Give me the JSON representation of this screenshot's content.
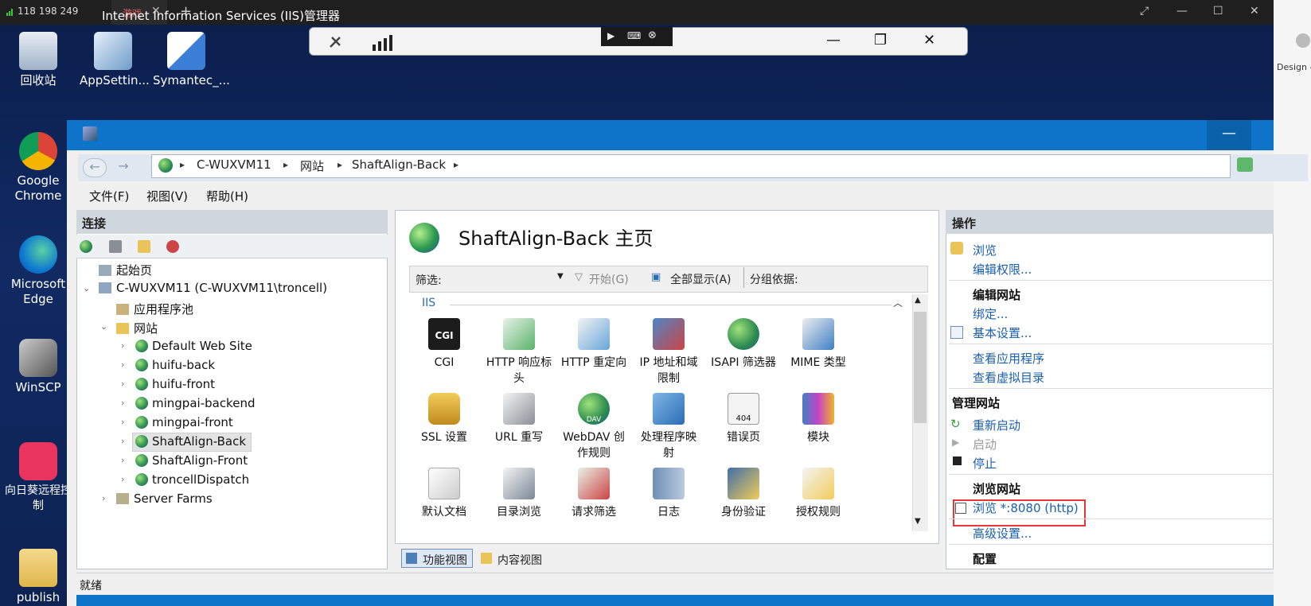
{
  "topbar": {
    "signal": "118 198 249",
    "tab_label": "游戏",
    "tab_close": "✕",
    "tab_add": "+",
    "ctl_restore": "⤢",
    "ctl_min": "—",
    "ctl_max": "☐",
    "ctl_close": "✕"
  },
  "desktop": {
    "icons": [
      {
        "label": "回收站"
      },
      {
        "label": "AppSettin..."
      },
      {
        "label": "Symantec_..."
      },
      {
        "label": "Google Chrome"
      },
      {
        "label": "Microsoft Edge"
      },
      {
        "label": "WinSCP"
      },
      {
        "label": "向日葵远程控制"
      },
      {
        "label": "publish"
      }
    ]
  },
  "remote_toolbar": {
    "min": "—",
    "max": "❐",
    "close": "✕"
  },
  "right_strip": {
    "text": "Design - B"
  },
  "iis": {
    "title": "Internet Information Services (IIS)管理器",
    "min": "—",
    "address": {
      "host": "C-WUXVM11",
      "sites": "网站",
      "site": "ShaftAlign-Back",
      "sep": "▸"
    },
    "menu": {
      "file": "文件(F)",
      "view": "视图(V)",
      "help": "帮助(H)"
    },
    "connections": {
      "title": "连接",
      "tree": {
        "start": "起始页",
        "server": "C-WUXVM11 (C-WUXVM11\\troncell)",
        "apppools": "应用程序池",
        "sites": "网站",
        "site_list": [
          "Default Web Site",
          "huifu-back",
          "huifu-front",
          "mingpai-backend",
          "mingpai-front",
          "ShaftAlign-Back",
          "ShaftAlign-Front",
          "troncellDispatch"
        ],
        "farms": "Server Farms"
      }
    },
    "center": {
      "title": "ShaftAlign-Back 主页",
      "filter_label": "筛选:",
      "start": "开始(G)",
      "show_all": "全部显示(A)",
      "group_by": "分组依据:",
      "group": "IIS",
      "features": [
        {
          "l1": "CGI",
          "l2": ""
        },
        {
          "l1": "HTTP 响应标",
          "l2": "头"
        },
        {
          "l1": "HTTP 重定向",
          "l2": ""
        },
        {
          "l1": "IP 地址和域",
          "l2": "限制"
        },
        {
          "l1": "ISAPI 筛选器",
          "l2": ""
        },
        {
          "l1": "MIME 类型",
          "l2": ""
        },
        {
          "l1": "SSL 设置",
          "l2": ""
        },
        {
          "l1": "URL 重写",
          "l2": ""
        },
        {
          "l1": "WebDAV 创",
          "l2": "作规则"
        },
        {
          "l1": "处理程序映",
          "l2": "射"
        },
        {
          "l1": "错误页",
          "l2": ""
        },
        {
          "l1": "模块",
          "l2": ""
        },
        {
          "l1": "默认文档",
          "l2": ""
        },
        {
          "l1": "目录浏览",
          "l2": ""
        },
        {
          "l1": "请求筛选",
          "l2": ""
        },
        {
          "l1": "日志",
          "l2": ""
        },
        {
          "l1": "身份验证",
          "l2": ""
        },
        {
          "l1": "授权规则",
          "l2": ""
        }
      ],
      "cgi_icon_text": "CGI",
      "err_icon_text": "404",
      "dav_icon_text": "DAV",
      "tab_features": "功能视图",
      "tab_content": "内容视图"
    },
    "actions": {
      "title": "操作",
      "browse": "浏览",
      "edit_perm": "编辑权限...",
      "edit_site": "编辑网站",
      "bindings": "绑定...",
      "basic": "基本设置...",
      "view_apps": "查看应用程序",
      "view_vdirs": "查看虚拟目录",
      "manage_site": "管理网站",
      "restart": "重新启动",
      "start": "启动",
      "stop": "停止",
      "browse_site": "浏览网站",
      "browse_8080": "浏览 *:8080 (http)",
      "advanced": "高级设置...",
      "config": "配置"
    },
    "status": "就绪"
  }
}
